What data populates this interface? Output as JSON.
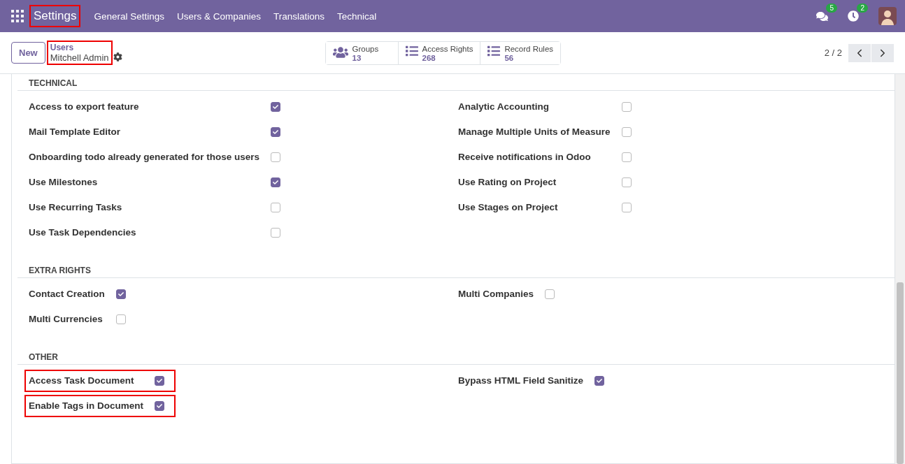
{
  "navbar": {
    "app": {
      "label": "Settings",
      "highlighted": true
    },
    "menu": [
      "General Settings",
      "Users & Companies",
      "Translations",
      "Technical"
    ],
    "messages_badge": "5",
    "activities_badge": "2"
  },
  "control_panel": {
    "new_button": "New",
    "breadcrumb": {
      "parent": "Users",
      "current": "Mitchell Admin",
      "highlighted": true
    },
    "smart_buttons": [
      {
        "kind": "groups",
        "label": "Groups",
        "count": "13"
      },
      {
        "kind": "list",
        "label": "Access Rights",
        "count": "268"
      },
      {
        "kind": "list",
        "label": "Record Rules",
        "count": "56"
      }
    ],
    "pager": "2 / 2"
  },
  "sections": [
    {
      "title": "TECHNICAL",
      "left": [
        {
          "label": "Access to export feature",
          "checked": true,
          "highlighted": false
        },
        {
          "label": "Mail Template Editor",
          "checked": true,
          "highlighted": false
        },
        {
          "label": "Onboarding todo already generated for those users",
          "checked": false,
          "highlighted": false
        },
        {
          "label": "Use Milestones",
          "checked": true,
          "highlighted": false
        },
        {
          "label": "Use Recurring Tasks",
          "checked": false,
          "highlighted": false
        },
        {
          "label": "Use Task Dependencies",
          "checked": false,
          "highlighted": false
        }
      ],
      "right": [
        {
          "label": "Analytic Accounting",
          "checked": false,
          "highlighted": false
        },
        {
          "label": "Manage Multiple Units of Measure",
          "checked": false,
          "highlighted": false
        },
        {
          "label": "Receive notifications in Odoo",
          "checked": false,
          "highlighted": false
        },
        {
          "label": "Use Rating on Project",
          "checked": false,
          "highlighted": false
        },
        {
          "label": "Use Stages on Project",
          "checked": false,
          "highlighted": false
        }
      ]
    },
    {
      "title": "EXTRA RIGHTS",
      "left": [
        {
          "label": "Contact Creation",
          "checked": true,
          "highlighted": false
        },
        {
          "label": "Multi Currencies",
          "checked": false,
          "highlighted": false
        }
      ],
      "right": [
        {
          "label": "Multi Companies",
          "checked": false,
          "highlighted": false
        }
      ]
    },
    {
      "title": "OTHER",
      "left": [
        {
          "label": "Access Task Document",
          "checked": true,
          "highlighted": true
        },
        {
          "label": "Enable Tags in Document",
          "checked": true,
          "highlighted": true
        }
      ],
      "right": [
        {
          "label": "Bypass HTML Field Sanitize",
          "checked": true,
          "highlighted": false
        }
      ]
    }
  ]
}
